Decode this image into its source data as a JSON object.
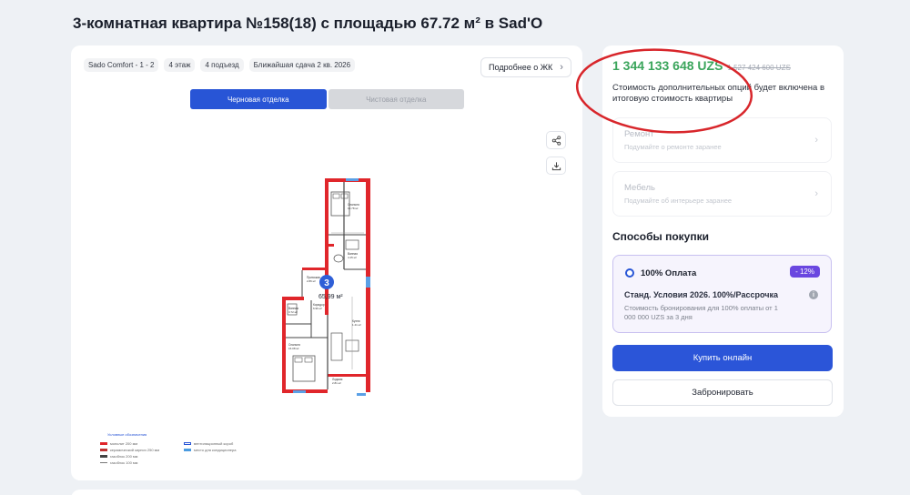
{
  "page": {
    "title": "3-комнатная квартира №158(18) с площадью 67.72 м² в Sad'O"
  },
  "chips": [
    "Sado Comfort - 1 - 2",
    "4 этаж",
    "4 подъезд",
    "Ближайшая сдача 2 кв. 2026"
  ],
  "more_button": "Подробнее о ЖК",
  "finish_tabs": {
    "rough": "Черновая отделка",
    "clean": "Чистовая отделка"
  },
  "floorplan": {
    "room_count": "3",
    "total_area": "65,99 м²",
    "rooms": [
      {
        "name": "Спальня",
        "area": "13.78 м²"
      },
      {
        "name": "Ванная",
        "area": "4.15 м²"
      },
      {
        "name": "Прихожая",
        "area": "2.86 м²"
      },
      {
        "name": "Ванная",
        "area": "3.72 м²"
      },
      {
        "name": "Коридор",
        "area": "6.96 м²"
      },
      {
        "name": "Спальня",
        "area": "16.08 м²"
      },
      {
        "name": "Лоджия",
        "area": "2.81 м²"
      },
      {
        "name": "Кухня",
        "area": "1.41 м²"
      }
    ]
  },
  "legend": {
    "title": "Условные обозначения",
    "items": [
      {
        "label": "монолит 200 мм",
        "color": "#e0262b"
      },
      {
        "label": "керамический кирпич 250 мм",
        "color": "#b33"
      },
      {
        "label": "газоблок 200 мм",
        "color": "#444"
      },
      {
        "label": "газоблок 100 мм",
        "color": "#777"
      },
      {
        "label": "вентиляционный короб",
        "color": "#2855d6"
      },
      {
        "label": "место для кондиционера",
        "color": "#4a9be0"
      }
    ]
  },
  "price": {
    "current": "1 344 133 648 UZS",
    "old": "1 527 424 600 UZS",
    "current_color": "#3ba55c"
  },
  "options_note": "Стоимость дополнительных опций будет включена в итоговую стоимость квартиры",
  "options": [
    {
      "title": "Ремонт",
      "subtitle": "Подумайте о ремонте заранее"
    },
    {
      "title": "Мебель",
      "subtitle": "Подумайте об интерьере заранее"
    }
  ],
  "purchase": {
    "heading": "Способы покупки",
    "method": "100% Оплата",
    "discount": "- 12%",
    "condition_title": "Станд. Условия 2026. 100%/Рассрочка",
    "condition_desc": "Стоимость бронирования для 100% оплаты от 1 000 000 UZS за 3 дня"
  },
  "buttons": {
    "buy": "Купить онлайн",
    "book": "Забронировать"
  },
  "colors": {
    "accent": "#2b55d8",
    "annotation": "#d8262b",
    "discount": "#6a47e0"
  },
  "icons": [
    "share-icon",
    "download-icon",
    "chevron-right-icon",
    "info-icon"
  ]
}
